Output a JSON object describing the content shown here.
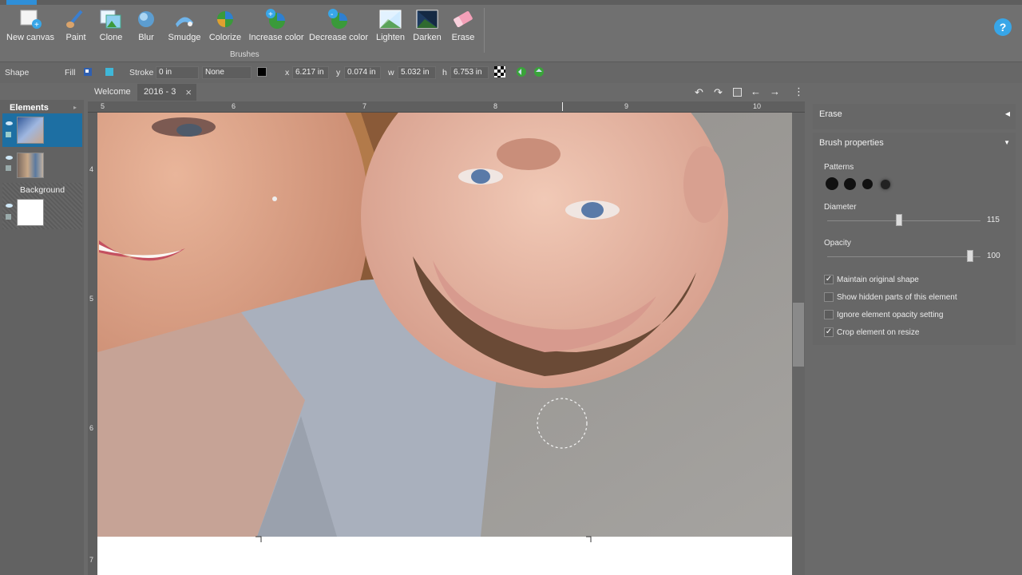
{
  "ribbon": {
    "tools": [
      {
        "id": "new-canvas",
        "label": "New canvas"
      },
      {
        "id": "paint",
        "label": "Paint"
      },
      {
        "id": "clone",
        "label": "Clone"
      },
      {
        "id": "blur",
        "label": "Blur"
      },
      {
        "id": "smudge",
        "label": "Smudge"
      },
      {
        "id": "colorize",
        "label": "Colorize"
      },
      {
        "id": "increase-color",
        "label": "Increase color"
      },
      {
        "id": "decrease-color",
        "label": "Decrease color"
      },
      {
        "id": "lighten",
        "label": "Lighten"
      },
      {
        "id": "darken",
        "label": "Darken"
      },
      {
        "id": "erase",
        "label": "Erase"
      }
    ],
    "group_label": "Brushes",
    "help_label": "?"
  },
  "propbar": {
    "shape_label": "Shape",
    "fill_label": "Fill",
    "stroke_label": "Stroke",
    "stroke_width": "0 in",
    "stroke_style": "None",
    "x_label": "x",
    "x_value": "6.217 in",
    "y_label": "y",
    "y_value": "0.074 in",
    "w_label": "w",
    "w_value": "5.032 in",
    "h_label": "h",
    "h_value": "6.753 in",
    "fill_color": "#3fb7d8",
    "stroke_color": "#000000"
  },
  "tabs": [
    {
      "label": "Welcome"
    },
    {
      "label": "2016 - 3"
    }
  ],
  "tab_close": "×",
  "elements_panel": {
    "title": "Elements",
    "background_label": "Background"
  },
  "ruler": {
    "h_labels": [
      "5",
      "6",
      "7",
      "8",
      "9",
      "10"
    ],
    "v_labels": [
      "4",
      "5",
      "6",
      "7"
    ]
  },
  "right_panel": {
    "erase_title": "Erase",
    "brush_props_title": "Brush properties",
    "patterns_label": "Patterns",
    "diameter_label": "Diameter",
    "diameter_value": "115",
    "opacity_label": "Opacity",
    "opacity_value": "100",
    "checkboxes": [
      {
        "label": "Maintain original shape",
        "checked": true
      },
      {
        "label": "Show hidden parts of this element",
        "checked": false
      },
      {
        "label": "Ignore element opacity setting",
        "checked": false
      },
      {
        "label": "Crop element on resize",
        "checked": true
      }
    ]
  },
  "colors": {
    "accent": "#2f8fd8",
    "selected_layer": "#1d6fa3"
  }
}
